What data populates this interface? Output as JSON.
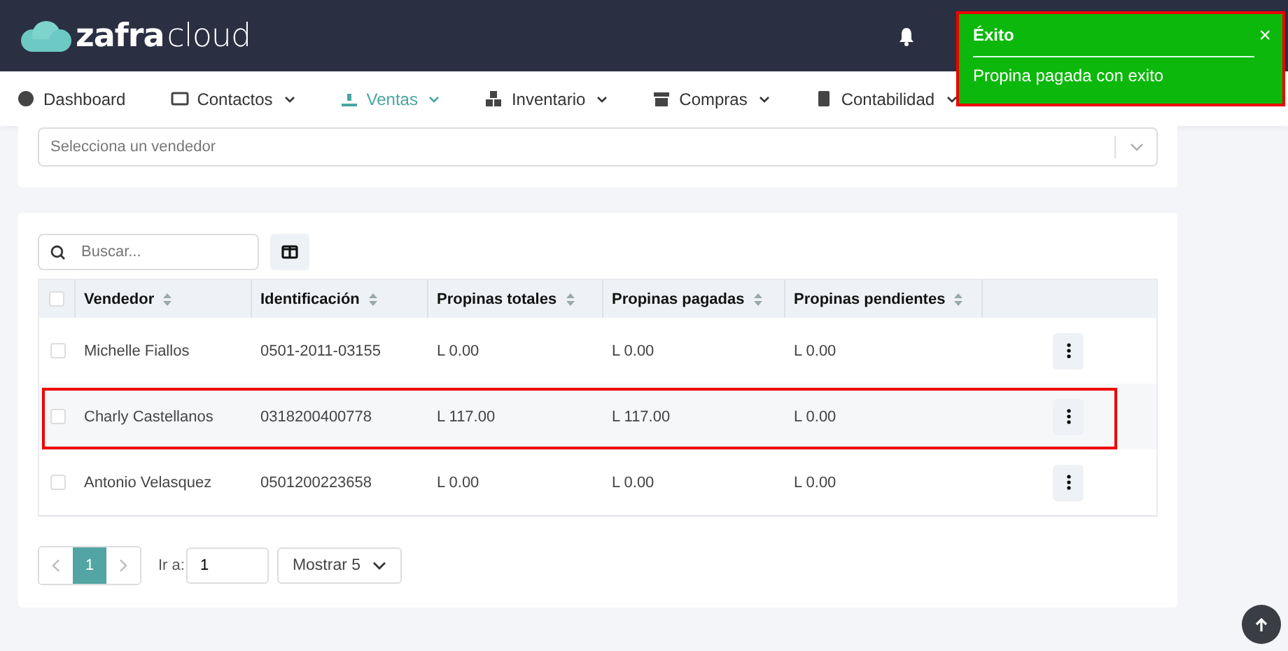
{
  "header": {
    "logo_bold": "zafra",
    "logo_light": "cloud"
  },
  "nav": [
    {
      "label": "Dashboard",
      "selected": false,
      "dropdown": false
    },
    {
      "label": "Contactos",
      "selected": false,
      "dropdown": true
    },
    {
      "label": "Ventas",
      "selected": true,
      "dropdown": true
    },
    {
      "label": "Inventario",
      "selected": false,
      "dropdown": true
    },
    {
      "label": "Compras",
      "selected": false,
      "dropdown": true
    },
    {
      "label": "Contabilidad",
      "selected": false,
      "dropdown": true
    }
  ],
  "vendor_select": {
    "placeholder": "Selecciona un vendedor"
  },
  "search": {
    "placeholder": "Buscar..."
  },
  "table": {
    "header_checked": false,
    "columns": [
      "Vendedor",
      "Identificación",
      "Propinas totales",
      "Propinas pagadas",
      "Propinas pendientes"
    ],
    "rows": [
      {
        "checked": false,
        "highlighted": false,
        "cells": [
          "Michelle Fiallos",
          "0501-2011-03155",
          "L 0.00",
          "L 0.00",
          "L 0.00"
        ]
      },
      {
        "checked": false,
        "highlighted": true,
        "cells": [
          "Charly Castellanos",
          "0318200400778",
          "L 117.00",
          "L 117.00",
          "L 0.00"
        ]
      },
      {
        "checked": false,
        "highlighted": false,
        "cells": [
          "Antonio Velasquez",
          "0501200223658",
          "L 0.00",
          "L 0.00",
          "L 0.00"
        ]
      }
    ]
  },
  "pagination": {
    "pages": [
      {
        "label": "1",
        "selected": true
      }
    ],
    "goto_label": "Ir a:",
    "goto_value": "1",
    "page_size": "Mostrar 5"
  },
  "toast": {
    "title": "Éxito",
    "message": "Propina pagada con exito",
    "close": "×",
    "highlighted": true
  }
}
